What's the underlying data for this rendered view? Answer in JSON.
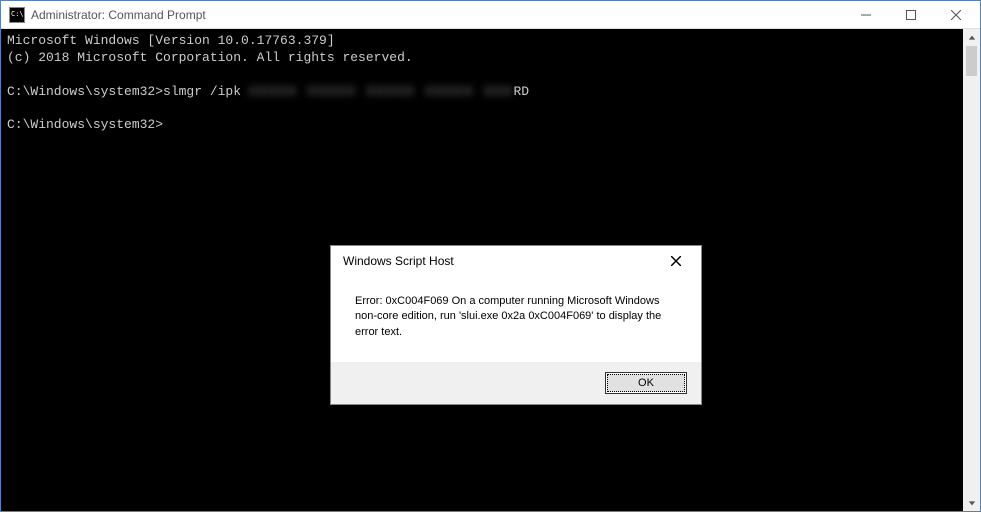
{
  "titlebar": {
    "icon_text": "C:\\",
    "title": "Administrator: Command Prompt"
  },
  "console": {
    "line1": "Microsoft Windows [Version 10.0.17763.379]",
    "line2": "(c) 2018 Microsoft Corporation. All rights reserved.",
    "line3_prefix": "C:\\Windows\\system32>slmgr /ipk ",
    "line3_blur": "XXXXX XXXXX XXXXX XXXXX XXX",
    "line3_suffix": "RD",
    "line4": "C:\\Windows\\system32>"
  },
  "dialog": {
    "title": "Windows Script Host",
    "message": "Error: 0xC004F069 On a computer running Microsoft Windows non-core edition, run 'slui.exe 0x2a 0xC004F069' to display the error text.",
    "ok_label": "OK"
  }
}
